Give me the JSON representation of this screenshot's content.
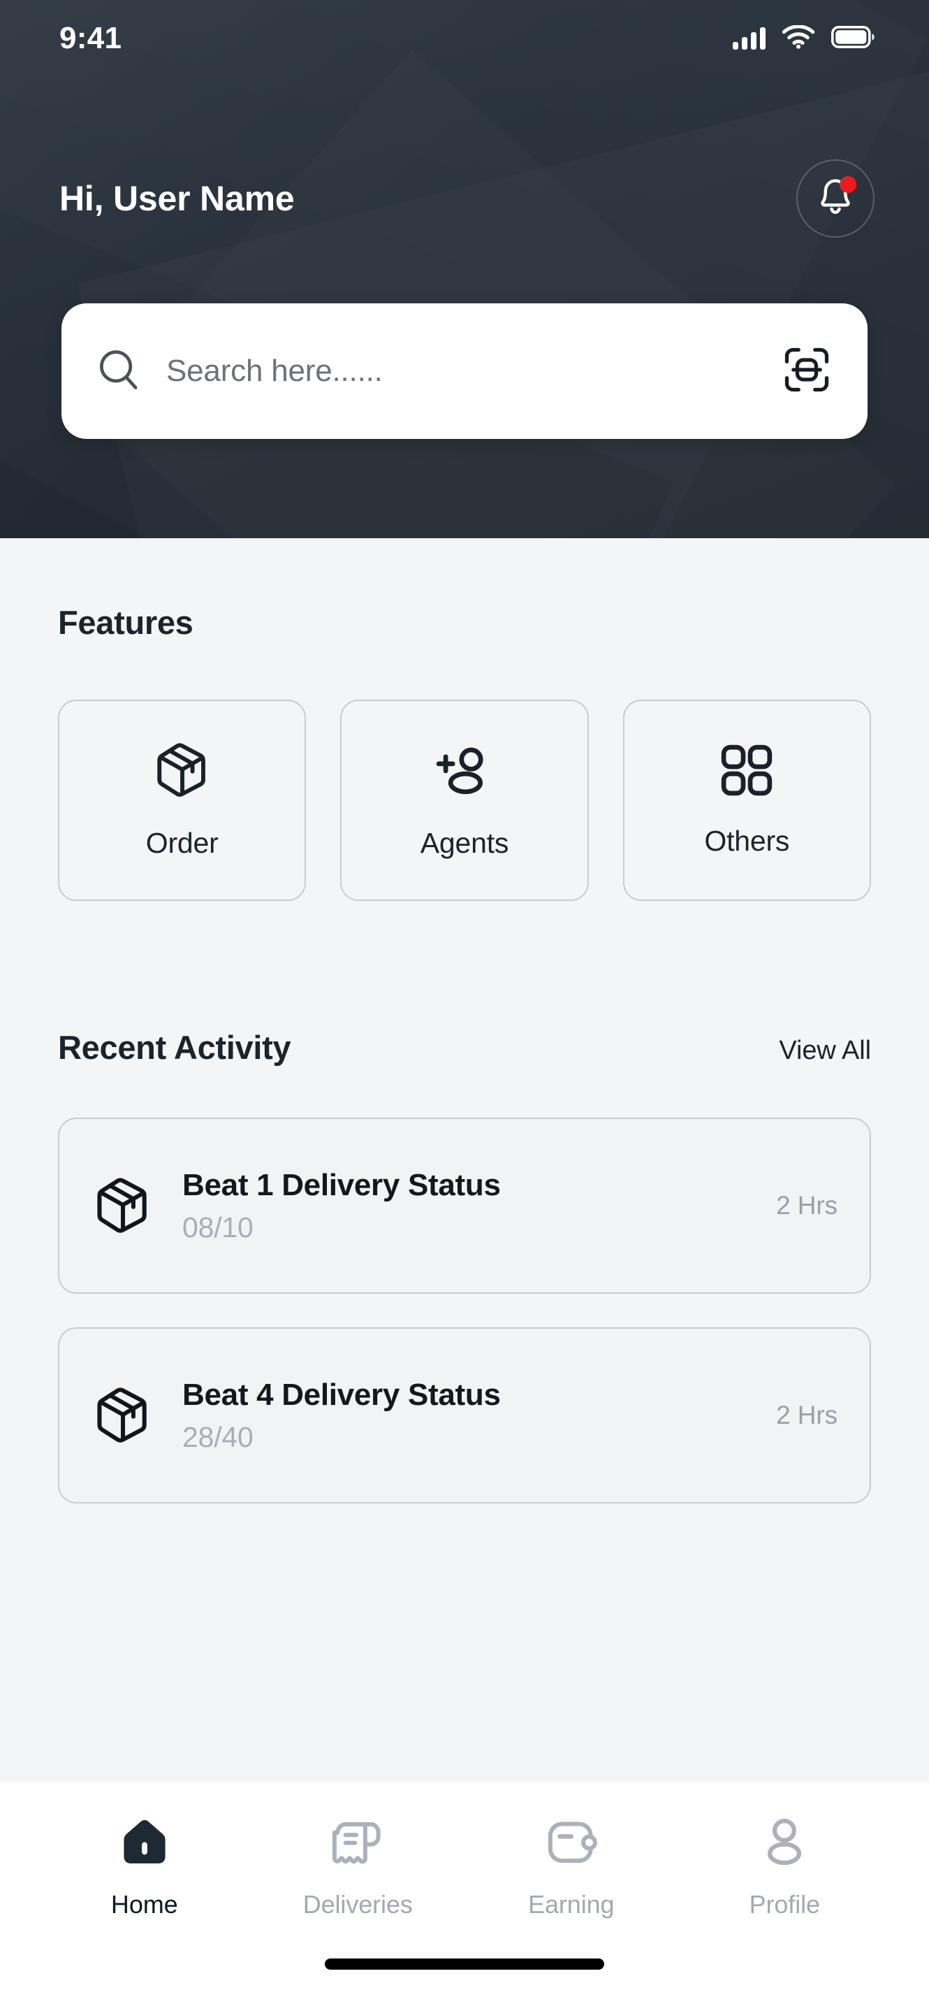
{
  "status_bar": {
    "time": "9:41",
    "signal_icon": "cellular-signal-icon",
    "wifi_icon": "wifi-icon",
    "battery_icon": "battery-full-icon"
  },
  "header": {
    "greeting": "Hi, User Name",
    "notification": {
      "icon": "bell-icon",
      "has_unread_dot": true,
      "dot_color": "#ED1C1C"
    },
    "background_color": "#262F39"
  },
  "search": {
    "placeholder": "Search here......",
    "search_icon": "search-icon",
    "scan_icon": "scan-qr-icon"
  },
  "features": {
    "title": "Features",
    "items": [
      {
        "label": "Order",
        "icon": "package-box-icon"
      },
      {
        "label": "Agents",
        "icon": "add-person-icon"
      },
      {
        "label": "Others",
        "icon": "grid-four-squares-icon"
      }
    ]
  },
  "recent_activity": {
    "title": "Recent Activity",
    "view_all_label": "View All",
    "items": [
      {
        "icon": "package-box-icon",
        "title": "Beat 1 Delivery Status",
        "subtitle": "08/10",
        "time": "2 Hrs"
      },
      {
        "icon": "package-box-icon",
        "title": "Beat 4 Delivery Status",
        "subtitle": "28/40",
        "time": "2 Hrs"
      }
    ]
  },
  "bottom_nav": {
    "items": [
      {
        "label": "Home",
        "icon": "home-icon",
        "active": true
      },
      {
        "label": "Deliveries",
        "icon": "receipt-icon",
        "active": false
      },
      {
        "label": "Earning",
        "icon": "wallet-icon",
        "active": false
      },
      {
        "label": "Profile",
        "icon": "person-icon",
        "active": false
      }
    ],
    "active_color": "#11181F",
    "inactive_color": "#A4A8B2"
  }
}
